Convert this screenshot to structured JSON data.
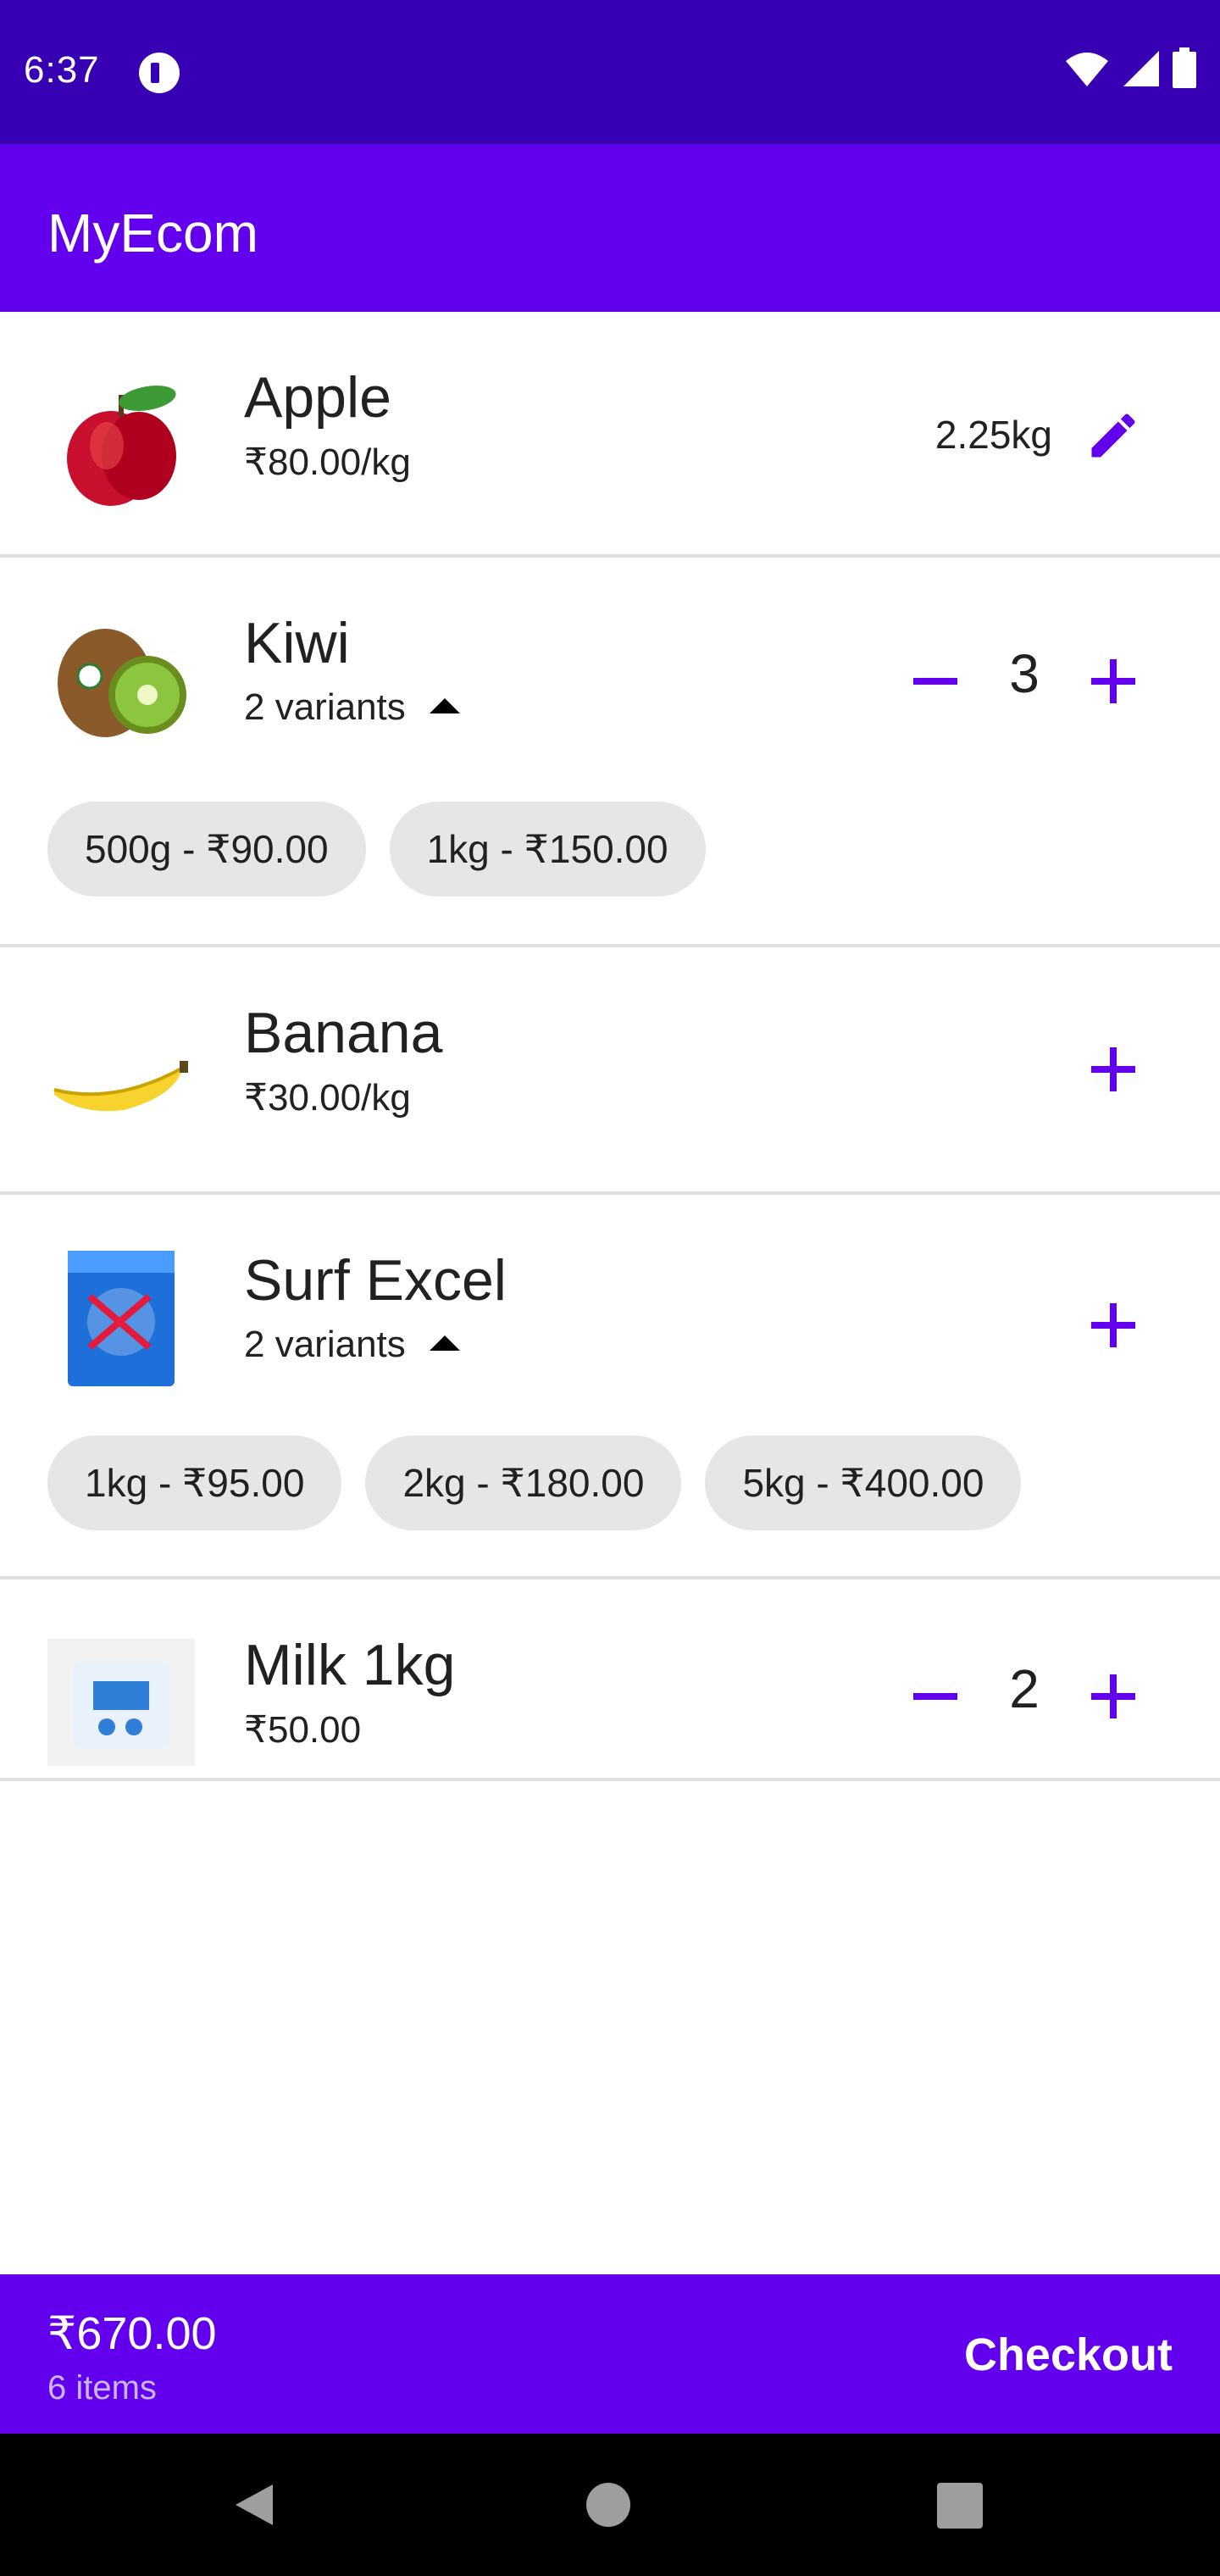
{
  "status_bar": {
    "time": "6:37"
  },
  "app_bar": {
    "title": "MyEcom"
  },
  "products": [
    {
      "name": "Apple",
      "price": "₹80.00/kg",
      "quantity": "2.25kg"
    },
    {
      "name": "Kiwi",
      "variants_label": "2 variants",
      "quantity": "3",
      "variants": [
        "500g - ₹90.00",
        "1kg - ₹150.00"
      ]
    },
    {
      "name": "Banana",
      "price": "₹30.00/kg"
    },
    {
      "name": "Surf Excel",
      "variants_label": "2 variants",
      "variants": [
        "1kg - ₹95.00",
        "2kg - ₹180.00",
        "5kg - ₹400.00"
      ]
    },
    {
      "name": "Milk 1kg",
      "price": "₹50.00",
      "quantity": "2"
    }
  ],
  "cart": {
    "total": "₹670.00",
    "items": "6 items",
    "checkout_label": "Checkout"
  },
  "colors": {
    "primary": "#6200ee",
    "primary_dark": "#3700b3",
    "chip_bg": "#e6e6e6"
  },
  "icons": [
    "edit-icon",
    "plus-icon",
    "minus-icon",
    "caret-up-icon",
    "wifi-icon",
    "signal-icon",
    "battery-icon",
    "back-icon",
    "home-icon",
    "recents-icon"
  ]
}
